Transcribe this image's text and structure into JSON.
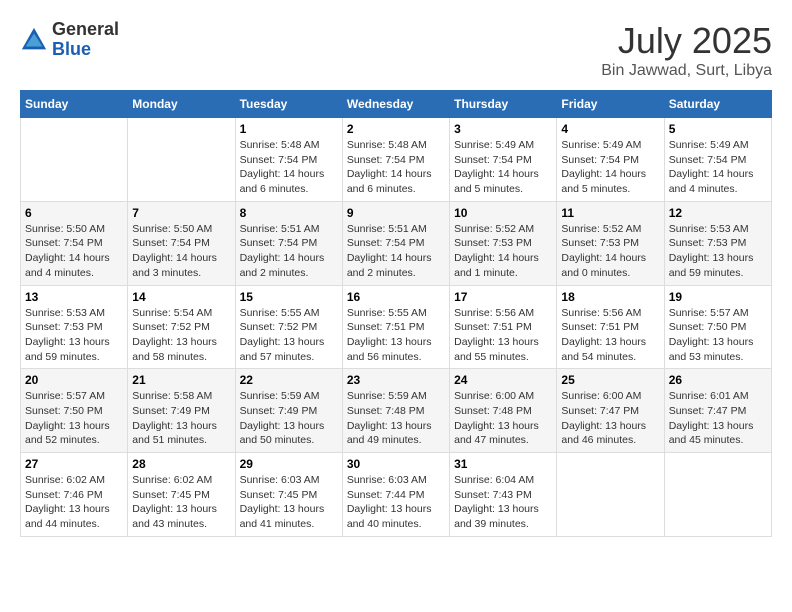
{
  "header": {
    "logo": {
      "general": "General",
      "blue": "Blue"
    },
    "title": "July 2025",
    "location": "Bin Jawwad, Surt, Libya"
  },
  "calendar": {
    "weekdays": [
      "Sunday",
      "Monday",
      "Tuesday",
      "Wednesday",
      "Thursday",
      "Friday",
      "Saturday"
    ],
    "weeks": [
      [
        {
          "day": null,
          "info": null
        },
        {
          "day": null,
          "info": null
        },
        {
          "day": "1",
          "info": "Sunrise: 5:48 AM\nSunset: 7:54 PM\nDaylight: 14 hours\nand 6 minutes."
        },
        {
          "day": "2",
          "info": "Sunrise: 5:48 AM\nSunset: 7:54 PM\nDaylight: 14 hours\nand 6 minutes."
        },
        {
          "day": "3",
          "info": "Sunrise: 5:49 AM\nSunset: 7:54 PM\nDaylight: 14 hours\nand 5 minutes."
        },
        {
          "day": "4",
          "info": "Sunrise: 5:49 AM\nSunset: 7:54 PM\nDaylight: 14 hours\nand 5 minutes."
        },
        {
          "day": "5",
          "info": "Sunrise: 5:49 AM\nSunset: 7:54 PM\nDaylight: 14 hours\nand 4 minutes."
        }
      ],
      [
        {
          "day": "6",
          "info": "Sunrise: 5:50 AM\nSunset: 7:54 PM\nDaylight: 14 hours\nand 4 minutes."
        },
        {
          "day": "7",
          "info": "Sunrise: 5:50 AM\nSunset: 7:54 PM\nDaylight: 14 hours\nand 3 minutes."
        },
        {
          "day": "8",
          "info": "Sunrise: 5:51 AM\nSunset: 7:54 PM\nDaylight: 14 hours\nand 2 minutes."
        },
        {
          "day": "9",
          "info": "Sunrise: 5:51 AM\nSunset: 7:54 PM\nDaylight: 14 hours\nand 2 minutes."
        },
        {
          "day": "10",
          "info": "Sunrise: 5:52 AM\nSunset: 7:53 PM\nDaylight: 14 hours\nand 1 minute."
        },
        {
          "day": "11",
          "info": "Sunrise: 5:52 AM\nSunset: 7:53 PM\nDaylight: 14 hours\nand 0 minutes."
        },
        {
          "day": "12",
          "info": "Sunrise: 5:53 AM\nSunset: 7:53 PM\nDaylight: 13 hours\nand 59 minutes."
        }
      ],
      [
        {
          "day": "13",
          "info": "Sunrise: 5:53 AM\nSunset: 7:53 PM\nDaylight: 13 hours\nand 59 minutes."
        },
        {
          "day": "14",
          "info": "Sunrise: 5:54 AM\nSunset: 7:52 PM\nDaylight: 13 hours\nand 58 minutes."
        },
        {
          "day": "15",
          "info": "Sunrise: 5:55 AM\nSunset: 7:52 PM\nDaylight: 13 hours\nand 57 minutes."
        },
        {
          "day": "16",
          "info": "Sunrise: 5:55 AM\nSunset: 7:51 PM\nDaylight: 13 hours\nand 56 minutes."
        },
        {
          "day": "17",
          "info": "Sunrise: 5:56 AM\nSunset: 7:51 PM\nDaylight: 13 hours\nand 55 minutes."
        },
        {
          "day": "18",
          "info": "Sunrise: 5:56 AM\nSunset: 7:51 PM\nDaylight: 13 hours\nand 54 minutes."
        },
        {
          "day": "19",
          "info": "Sunrise: 5:57 AM\nSunset: 7:50 PM\nDaylight: 13 hours\nand 53 minutes."
        }
      ],
      [
        {
          "day": "20",
          "info": "Sunrise: 5:57 AM\nSunset: 7:50 PM\nDaylight: 13 hours\nand 52 minutes."
        },
        {
          "day": "21",
          "info": "Sunrise: 5:58 AM\nSunset: 7:49 PM\nDaylight: 13 hours\nand 51 minutes."
        },
        {
          "day": "22",
          "info": "Sunrise: 5:59 AM\nSunset: 7:49 PM\nDaylight: 13 hours\nand 50 minutes."
        },
        {
          "day": "23",
          "info": "Sunrise: 5:59 AM\nSunset: 7:48 PM\nDaylight: 13 hours\nand 49 minutes."
        },
        {
          "day": "24",
          "info": "Sunrise: 6:00 AM\nSunset: 7:48 PM\nDaylight: 13 hours\nand 47 minutes."
        },
        {
          "day": "25",
          "info": "Sunrise: 6:00 AM\nSunset: 7:47 PM\nDaylight: 13 hours\nand 46 minutes."
        },
        {
          "day": "26",
          "info": "Sunrise: 6:01 AM\nSunset: 7:47 PM\nDaylight: 13 hours\nand 45 minutes."
        }
      ],
      [
        {
          "day": "27",
          "info": "Sunrise: 6:02 AM\nSunset: 7:46 PM\nDaylight: 13 hours\nand 44 minutes."
        },
        {
          "day": "28",
          "info": "Sunrise: 6:02 AM\nSunset: 7:45 PM\nDaylight: 13 hours\nand 43 minutes."
        },
        {
          "day": "29",
          "info": "Sunrise: 6:03 AM\nSunset: 7:45 PM\nDaylight: 13 hours\nand 41 minutes."
        },
        {
          "day": "30",
          "info": "Sunrise: 6:03 AM\nSunset: 7:44 PM\nDaylight: 13 hours\nand 40 minutes."
        },
        {
          "day": "31",
          "info": "Sunrise: 6:04 AM\nSunset: 7:43 PM\nDaylight: 13 hours\nand 39 minutes."
        },
        {
          "day": null,
          "info": null
        },
        {
          "day": null,
          "info": null
        }
      ]
    ]
  }
}
